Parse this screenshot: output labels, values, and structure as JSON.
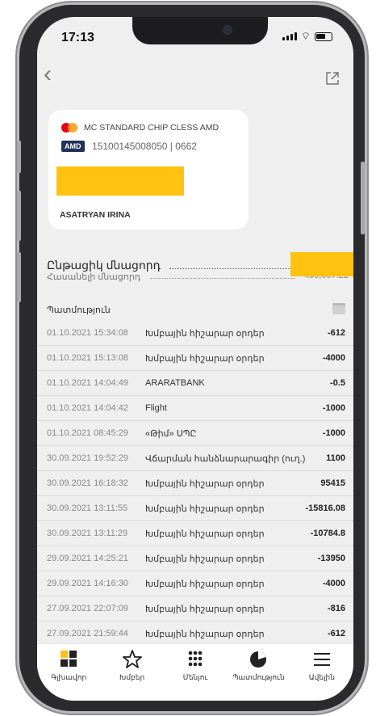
{
  "status_bar": {
    "time": "17:13"
  },
  "card": {
    "product_name": "MC STANDARD CHIP CLESS AMD",
    "currency_badge": "AMD",
    "account_number": "15100145008050 | 0662",
    "holder_name": "ASATRYAN IRINA"
  },
  "balances": {
    "current_label": "Ընթացիկ մնացորդ",
    "available_label": "Հասանելի մնացորդ",
    "available_value_partial": "400,007.22"
  },
  "history": {
    "title": "Պատմություն",
    "rows": [
      {
        "datetime": "01.10.2021 15:34:08",
        "description": "Խմբային հիշարար օրդեր",
        "amount": "-612"
      },
      {
        "datetime": "01.10.2021 15:13:08",
        "description": "Խմբային հիշարար օրդեր",
        "amount": "-4000"
      },
      {
        "datetime": "01.10.2021 14:04:49",
        "description": "ARARATBANK",
        "amount": "-0.5"
      },
      {
        "datetime": "01.10.2021 14:04:42",
        "description": "Flight",
        "amount": "-1000"
      },
      {
        "datetime": "01.10.2021 08:45:29",
        "description": "«Թիմ» ՍՊԸ",
        "amount": "-1000"
      },
      {
        "datetime": "30.09.2021 19:52:29",
        "description": "Վճարման հանձնարարագիր (ուղ.)",
        "amount": "1100"
      },
      {
        "datetime": "30.09.2021 16:18:32",
        "description": "Խմբային հիշարար օրդեր",
        "amount": "95415"
      },
      {
        "datetime": "30.09.2021 13:11:55",
        "description": "Խմբային հիշարար օրդեր",
        "amount": "-15816.08"
      },
      {
        "datetime": "30.09.2021 13:11:29",
        "description": "Խմբային հիշարար օրդեր",
        "amount": "-10784.8"
      },
      {
        "datetime": "29.09.2021 14:25:21",
        "description": "Խմբային հիշարար օրդեր",
        "amount": "-13950"
      },
      {
        "datetime": "29.09.2021 14:16:30",
        "description": "Խմբային հիշարար օրդեր",
        "amount": "-4000"
      },
      {
        "datetime": "27.09.2021 22:07:09",
        "description": "Խմբային հիշարար օրդեր",
        "amount": "-816"
      },
      {
        "datetime": "27.09.2021 21:59:44",
        "description": "Խմբային հիշարար օրդեր",
        "amount": "-612"
      }
    ]
  },
  "tabbar": {
    "home": "Գլխավոր",
    "favorites": "Խմբեր",
    "menu": "Մենյու",
    "history": "Պատմություն",
    "more": "Ավելին"
  },
  "colors": {
    "accent_yellow": "#ffc20e",
    "badge_navy": "#22305b"
  },
  "icons": [
    "back-arrow-icon",
    "share-icon",
    "mastercard-icon",
    "calendar-icon",
    "home-grid-icon",
    "star-icon",
    "dots-grid-icon",
    "pie-chart-icon",
    "hamburger-icon"
  ]
}
